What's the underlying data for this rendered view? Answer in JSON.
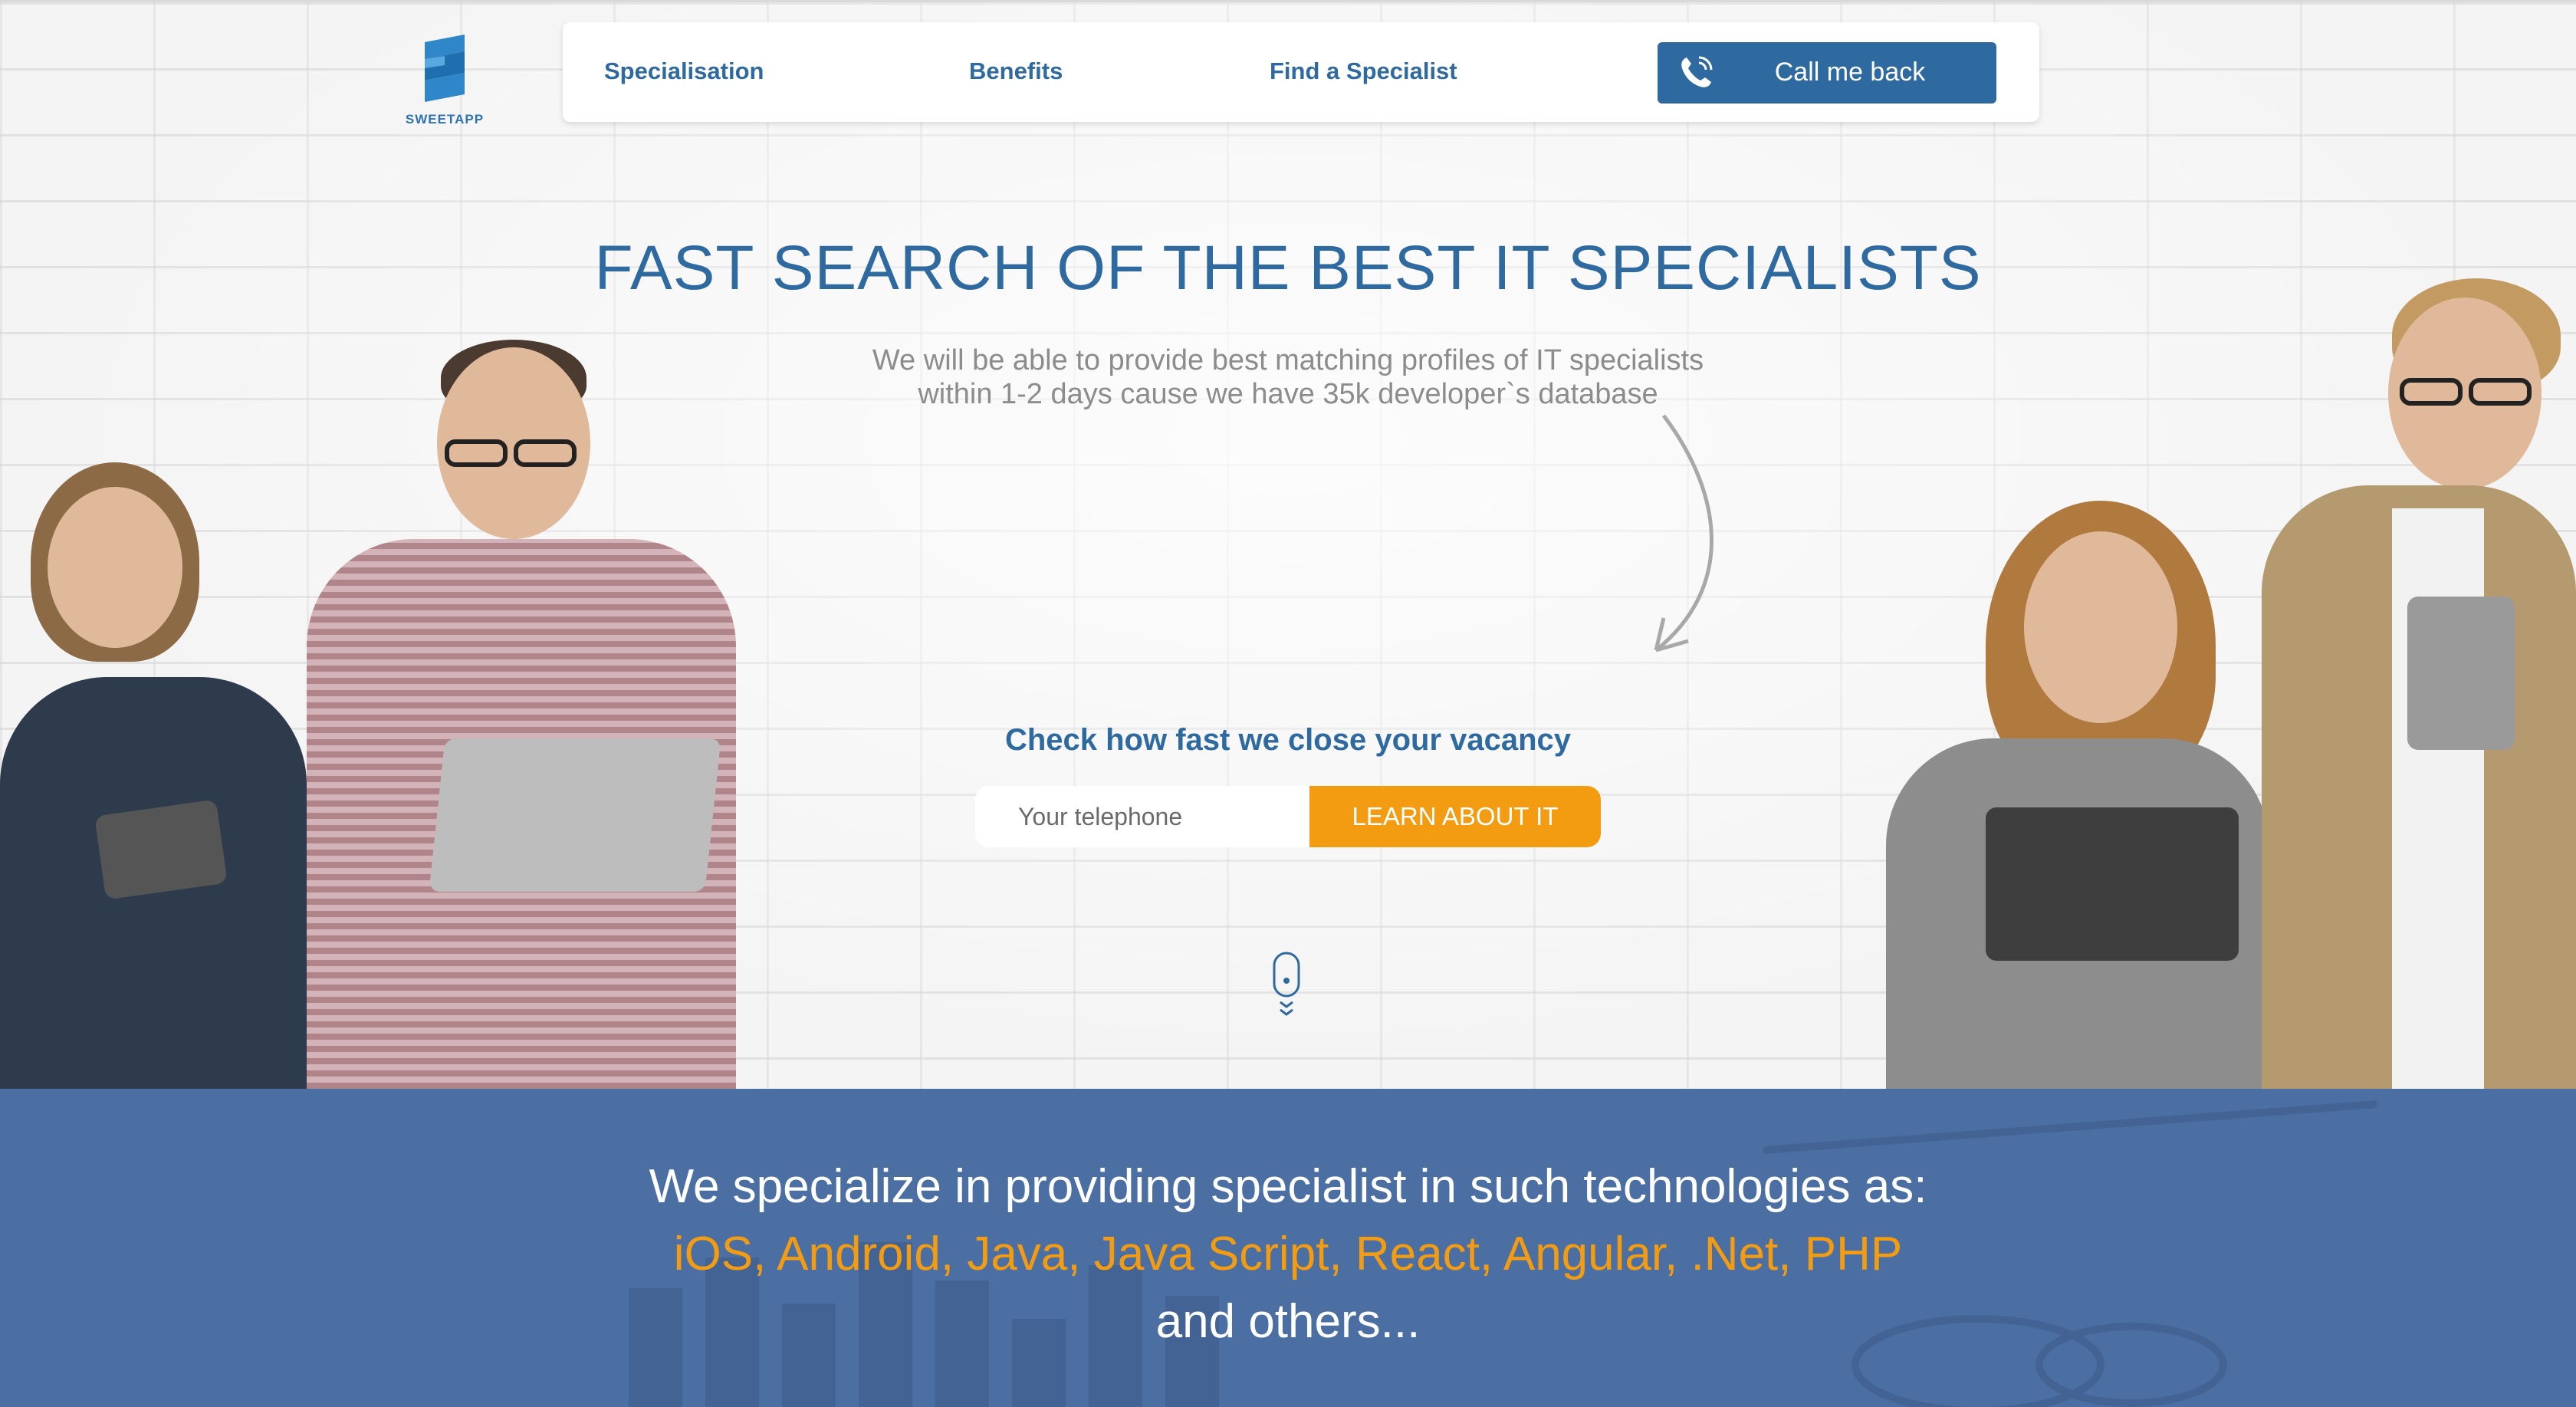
{
  "brand": {
    "logo_text": "SWEETAPP",
    "primary_color": "#2e6aa0",
    "accent_color": "#f39c12",
    "band_color": "#4c6fa3"
  },
  "nav": {
    "items": [
      {
        "label": "Specialisation"
      },
      {
        "label": "Benefits"
      },
      {
        "label": "Find a Specialist"
      }
    ],
    "callback": {
      "label": "Call me back",
      "icon": "phone-icon"
    }
  },
  "hero": {
    "title": "FAST SEARCH OF THE BEST IT SPECIALISTS",
    "subtitle_line1": "We will be able to provide best matching profiles of IT specialists",
    "subtitle_line2": "within 1-2 days cause we have 35k developer`s database"
  },
  "vacancy": {
    "title": "Check how fast we close your vacancy",
    "input_placeholder": "Your telephone",
    "button_label": "LEARN ABOUT IT"
  },
  "tech": {
    "line1": "We specialize in providing specialist in such technologies as:",
    "line2": "iOS, Android, Java, Java Script, React, Angular, .Net, PHP",
    "line3": "and others..."
  }
}
